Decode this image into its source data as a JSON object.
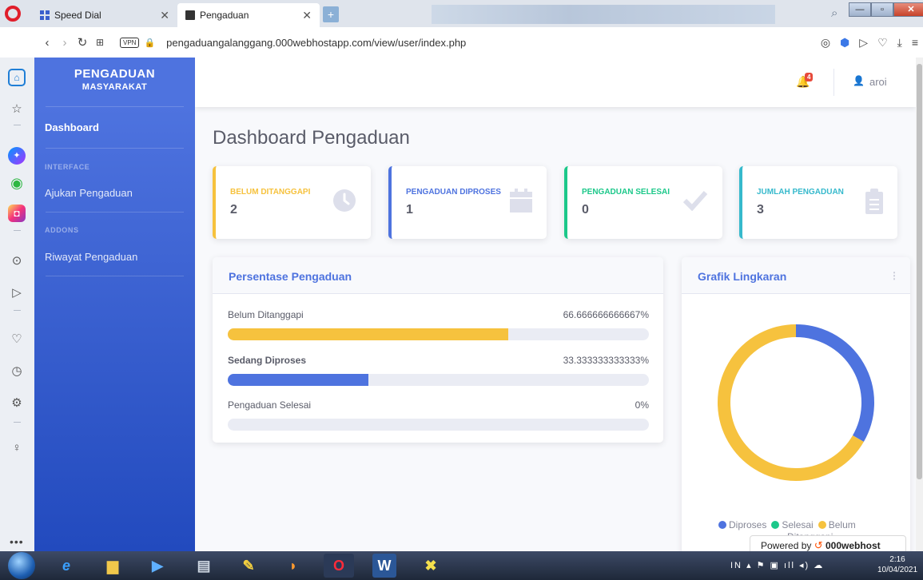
{
  "browser": {
    "tabs": [
      {
        "title": "Speed Dial",
        "active": false
      },
      {
        "title": "Pengaduan",
        "active": true
      }
    ],
    "new_tab_label": "+",
    "vpn_label": "VPN",
    "url": "pengaduangalanggang.000webhostapp.com/view/user/index.php"
  },
  "sidebar": {
    "brand_line1": "PENGADUAN",
    "brand_line2": "MASYARAKAT",
    "dashboard": "Dashboard",
    "heading_interface": "INTERFACE",
    "item_ajukan": "Ajukan Pengaduan",
    "heading_addons": "ADDONS",
    "item_riwayat": "Riwayat Pengaduan"
  },
  "topbar": {
    "notification_count": "4",
    "user_name": "aroi"
  },
  "page": {
    "title": "Dashboard Pengaduan"
  },
  "stats": [
    {
      "label": "BELUM DITANGGAPI",
      "value": "2",
      "color": "#f6c23e",
      "icon": "clock-icon"
    },
    {
      "label": "PENGADUAN DIPROSES",
      "value": "1",
      "color": "#4e73df",
      "icon": "calendar-icon"
    },
    {
      "label": "PENGADUAN SELESAI",
      "value": "0",
      "color": "#1cc88a",
      "icon": "check-icon"
    },
    {
      "label": "JUMLAH PENGADUAN",
      "value": "3",
      "color": "#36b9cc",
      "icon": "clipboard-icon"
    }
  ],
  "progress_card": {
    "title": "Persentase Pengaduan",
    "rows": [
      {
        "label": "Belum Ditanggapi",
        "value_text": "66.666666666667%",
        "percent": 66.666666666667,
        "color": "#f6c23e"
      },
      {
        "label": "Sedang Diproses",
        "value_text": "33.333333333333%",
        "percent": 33.333333333333,
        "color": "#4e73df"
      },
      {
        "label": "Pengaduan Selesai",
        "value_text": "0%",
        "percent": 0,
        "color": "#1cc88a"
      }
    ]
  },
  "pie_card": {
    "title": "Grafik Lingkaran",
    "legend": [
      {
        "name": "Diproses",
        "color": "#4e73df"
      },
      {
        "name": "Selesai",
        "color": "#1cc88a"
      },
      {
        "name": "Belum",
        "color": "#f6c23e"
      }
    ],
    "legend_line2": "Ditanggapi"
  },
  "chart_data": {
    "type": "pie",
    "categories": [
      "Diproses",
      "Selesai",
      "Belum"
    ],
    "values": [
      1,
      0,
      2
    ],
    "colors": [
      "#4e73df",
      "#1cc88a",
      "#f6c23e"
    ],
    "title": "Grafik Lingkaran",
    "legend": "bottom"
  },
  "footer": {
    "powered_prefix": "Powered by",
    "powered_brand": "000webhost"
  },
  "taskbar": {
    "lang": "IN",
    "time": "2:16",
    "date": "10/04/2021"
  }
}
